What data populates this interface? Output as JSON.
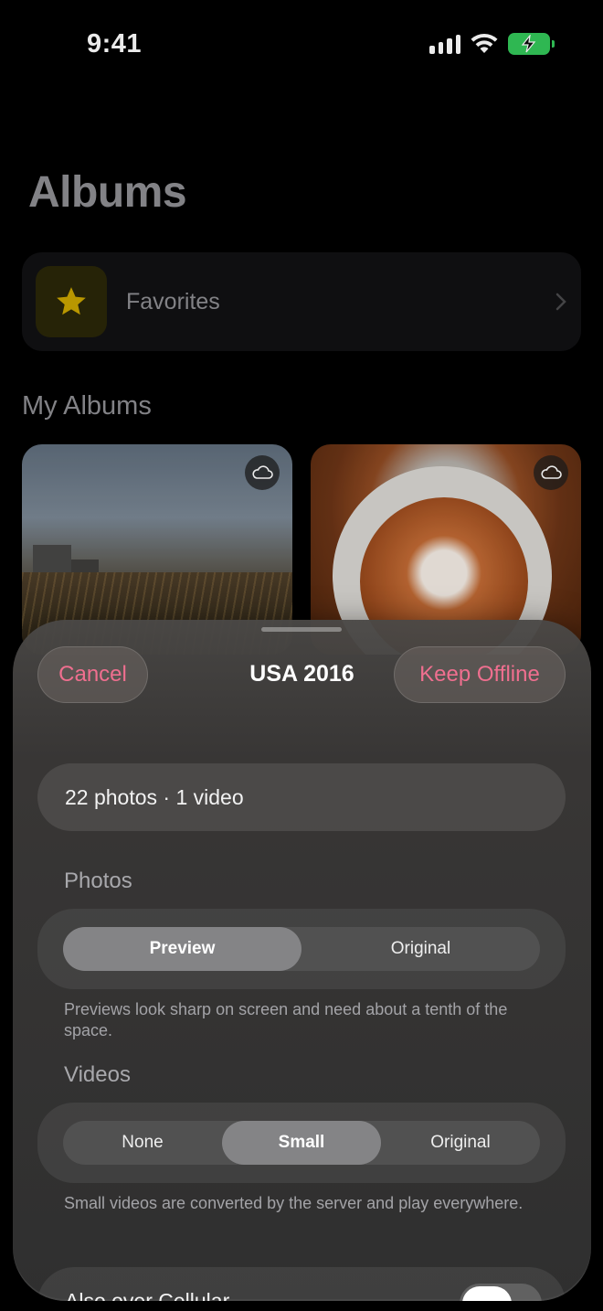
{
  "status_bar": {
    "time": "9:41"
  },
  "background": {
    "title": "Albums",
    "favorites_label": "Favorites",
    "section_title": "My Albums"
  },
  "sheet": {
    "cancel_label": "Cancel",
    "title": "USA 2016",
    "keep_offline_label": "Keep Offline",
    "summary": "22 photos · 1 video",
    "photos": {
      "label": "Photos",
      "options": [
        "Preview",
        "Original"
      ],
      "selected": "Preview",
      "footnote": "Previews look sharp on screen and need about a tenth of the space."
    },
    "videos": {
      "label": "Videos",
      "options": [
        "None",
        "Small",
        "Original"
      ],
      "selected": "Small",
      "footnote": "Small videos are converted by the server and play everywhere."
    },
    "cellular": {
      "label": "Also over Cellular",
      "enabled": true
    }
  },
  "colors": {
    "accent": "#ef6f8f",
    "battery": "#34c759",
    "star": "#c9a400"
  }
}
